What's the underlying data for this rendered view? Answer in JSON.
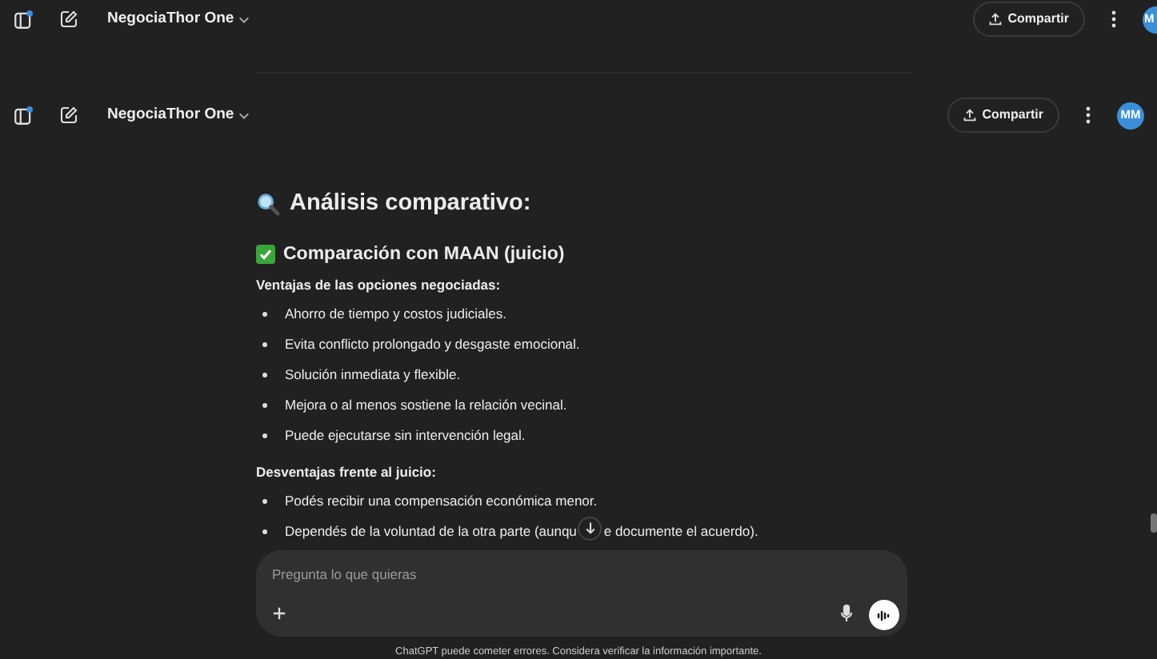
{
  "headers": [
    {
      "title": "NegociaThor One",
      "share": "Compartir",
      "avatar": "M",
      "cut": true
    },
    {
      "title": "NegociaThor One",
      "share": "Compartir",
      "avatar": "MM",
      "cut": false
    }
  ],
  "message": {
    "heading": "Análisis comparativo:",
    "subheading": "Comparación con MAAN (juicio)",
    "sections": [
      {
        "label": "Ventajas de las opciones negociadas:",
        "items": [
          {
            "parts": [
              "Ahorro de tiempo y costos judiciales."
            ]
          },
          {
            "parts": [
              "Evita conflicto prolongado y desgaste emocional."
            ]
          },
          {
            "parts": [
              "Solución inmediata y flexible."
            ]
          },
          {
            "parts": [
              "Mejora o al menos sostiene la relación vecinal."
            ]
          },
          {
            "parts": [
              "Puede ejecutarse sin intervención legal."
            ]
          }
        ]
      },
      {
        "label": "Desventajas frente al juicio:",
        "items": [
          {
            "parts": [
              "Podés recibir una compensación económica menor."
            ]
          },
          {
            "parts": [
              "Dependés de la voluntad de la otra parte (aunqu",
              "e documente el acuerdo)."
            ]
          }
        ]
      }
    ]
  },
  "composer": {
    "placeholder": "Pregunta lo que quieras"
  },
  "disclaimer": "ChatGPT puede cometer errores. Considera verificar la información importante."
}
